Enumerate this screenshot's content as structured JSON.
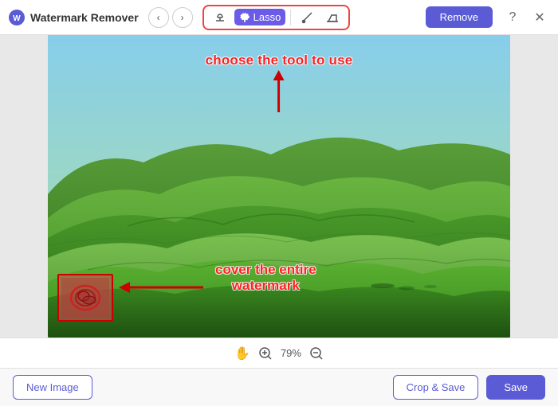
{
  "app": {
    "title": "Watermark Remover",
    "logo_unicode": "🔵"
  },
  "toolbar": {
    "back_label": "◀",
    "forward_label": "▶",
    "tools": [
      {
        "id": "stamp",
        "label": "✦",
        "active": false
      },
      {
        "id": "lasso",
        "label": "Lasso",
        "active": true
      },
      {
        "id": "brush",
        "label": "✏",
        "active": false
      },
      {
        "id": "eraser",
        "label": "◇",
        "active": false
      }
    ],
    "remove_label": "Remove",
    "help_label": "?",
    "close_label": "✕"
  },
  "canvas": {
    "annotation_tool_text": "choose the tool to use",
    "annotation_watermark_line1": "cover the entire",
    "annotation_watermark_line2": "watermark"
  },
  "statusbar": {
    "zoom_level": "79%"
  },
  "actionbar": {
    "new_image_label": "New Image",
    "crop_save_label": "Crop & Save",
    "save_label": "Save"
  }
}
